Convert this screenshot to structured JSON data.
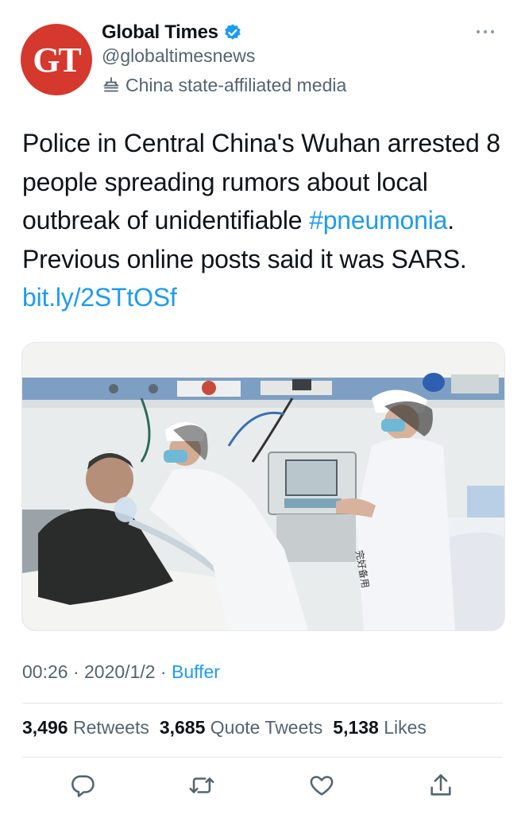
{
  "author": {
    "avatar_text": "GT",
    "name": "Global Times",
    "handle": "@globaltimesnews",
    "affiliation": "China state-affiliated media"
  },
  "tweet": {
    "text_part1": "Police in Central China's Wuhan arrested 8 people spreading rumors about local outbreak of unidentifiable ",
    "hashtag": "#pneumonia",
    "text_part2": ". Previous online posts said it was SARS. ",
    "link": "bit.ly/2STtOSf"
  },
  "media": {
    "icon": "photo-hospital-scene",
    "sign_text": "完好备用"
  },
  "meta": {
    "time": "00:26",
    "sep1": " · ",
    "date": "2020/1/2",
    "sep2": " · ",
    "source": "Buffer"
  },
  "stats": {
    "retweets_count": "3,496",
    "retweets_label": "Retweets",
    "quotes_count": "3,685",
    "quotes_label": "Quote Tweets",
    "likes_count": "5,138",
    "likes_label": "Likes"
  },
  "actions": [
    "reply-icon",
    "retweet-icon",
    "like-icon",
    "share-icon"
  ],
  "colors": {
    "accent": "#1d9bf0",
    "secondary_text": "#536471",
    "avatar_bg": "#d5382d"
  }
}
